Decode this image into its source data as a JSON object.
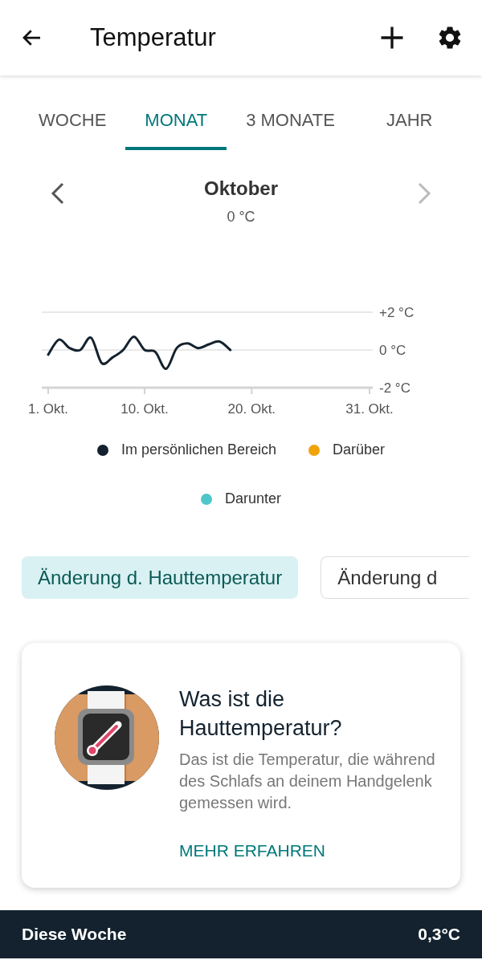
{
  "app_bar": {
    "title": "Temperatur"
  },
  "tabs": [
    {
      "label": "WOCHE",
      "selected": false
    },
    {
      "label": "MONAT",
      "selected": true
    },
    {
      "label": "3 MONATE",
      "selected": false
    },
    {
      "label": "JAHR",
      "selected": false
    }
  ],
  "period": {
    "title": "Oktober",
    "value": "0 °C",
    "next_disabled": true
  },
  "chart_data": {
    "type": "line",
    "x": [
      1,
      2,
      3,
      4,
      5,
      6,
      7,
      8,
      9,
      10,
      11,
      12,
      13,
      14,
      15,
      16,
      17,
      18
    ],
    "series": [
      {
        "color": "#13222e",
        "values": [
          -0.25,
          0.55,
          0.1,
          0.0,
          0.65,
          -0.7,
          -0.4,
          0.0,
          0.7,
          0.0,
          -0.1,
          -1.0,
          0.1,
          0.35,
          0.1,
          0.3,
          0.45,
          0.0
        ]
      }
    ],
    "xlim": [
      0.4,
      31.3
    ],
    "ylim": [
      -2,
      2
    ],
    "xticks": [
      {
        "value": 1,
        "label": "1. Okt."
      },
      {
        "value": 10,
        "label": "10. Okt."
      },
      {
        "value": 20,
        "label": "20. Okt."
      },
      {
        "value": 31,
        "label": "31. Okt."
      }
    ],
    "yticks": [
      {
        "value": 2,
        "label": "+2 °C"
      },
      {
        "value": 0,
        "label": "0 °C"
      },
      {
        "value": -2,
        "label": "-2 °C"
      }
    ]
  },
  "legend": [
    {
      "label": "Im persönlichen Bereich",
      "color": "#13222e"
    },
    {
      "label": "Darüber",
      "color": "#f0a30a"
    },
    {
      "label": "Darunter",
      "color": "#4fc6cc"
    }
  ],
  "chips": [
    {
      "label": "Änderung d. Hauttemperatur",
      "selected": true
    },
    {
      "label": "Änderung d",
      "selected": false
    }
  ],
  "info_card": {
    "title": "Was ist die Hauttemperatur?",
    "text": "Das ist die Temperatur, die während des Schlafs an deinem Handgelenk gemessen wird.",
    "link": "MEHR ERFAHREN"
  },
  "summary_bar": {
    "label": "Diese Woche",
    "value": "0,3°C"
  }
}
